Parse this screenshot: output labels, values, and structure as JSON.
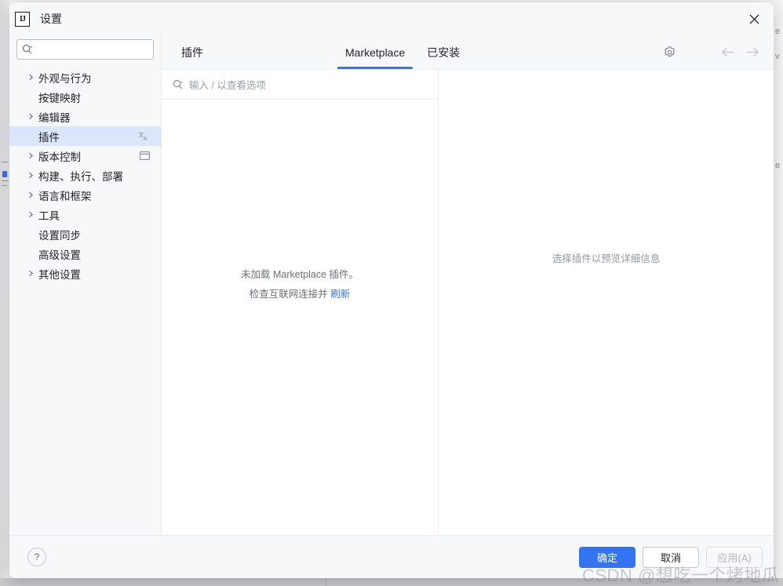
{
  "window": {
    "title": "设置",
    "app_icon": "intellij-idea-icon",
    "close_icon": "close-icon"
  },
  "sidebar": {
    "search": {
      "value": "",
      "placeholder": "",
      "icon": "search-icon"
    },
    "items": [
      {
        "label": "外观与行为",
        "expandable": true,
        "selected": false,
        "badge": ""
      },
      {
        "label": "按键映射",
        "expandable": false,
        "selected": false,
        "badge": ""
      },
      {
        "label": "编辑器",
        "expandable": true,
        "selected": false,
        "badge": ""
      },
      {
        "label": "插件",
        "expandable": false,
        "selected": true,
        "badge": "translate-icon"
      },
      {
        "label": "版本控制",
        "expandable": true,
        "selected": false,
        "badge": "panel-icon"
      },
      {
        "label": "构建、执行、部署",
        "expandable": true,
        "selected": false,
        "badge": ""
      },
      {
        "label": "语言和框架",
        "expandable": true,
        "selected": false,
        "badge": ""
      },
      {
        "label": "工具",
        "expandable": true,
        "selected": false,
        "badge": ""
      },
      {
        "label": "设置同步",
        "expandable": false,
        "selected": false,
        "badge": ""
      },
      {
        "label": "高级设置",
        "expandable": false,
        "selected": false,
        "badge": ""
      },
      {
        "label": "其他设置",
        "expandable": true,
        "selected": false,
        "badge": ""
      }
    ]
  },
  "content": {
    "pane_title": "插件",
    "tabs": [
      {
        "label": "Marketplace",
        "active": true
      },
      {
        "label": "已安装",
        "active": false
      }
    ],
    "gear_icon": "gear-icon",
    "nav": {
      "back_icon": "arrow-left-icon",
      "forward_icon": "arrow-right-icon"
    },
    "plugin_search": {
      "icon": "search-icon",
      "placeholder_prefix": "输入 ",
      "placeholder_slash": "/",
      "placeholder_suffix": " 以查看选项",
      "value": ""
    },
    "empty_state": {
      "line1": "未加载 Marketplace 插件。",
      "line2_prefix": "检查互联网连接并 ",
      "line2_link": "刷新"
    },
    "detail_placeholder": "选择插件以预览详细信息"
  },
  "footer": {
    "help_label": "?",
    "ok_label": "确定",
    "cancel_label": "取消",
    "apply_label": "应用(A)"
  },
  "watermark": "CSDN @想吃一个烤地瓜",
  "backdrop": {
    "glyphs": [
      "e",
      "v",
      "e"
    ]
  },
  "colors": {
    "accent": "#3574f0",
    "selection": "#dbe6fa",
    "link": "#2e72d2",
    "panel": "#f7f8fa",
    "divider": "#ebecf0"
  }
}
